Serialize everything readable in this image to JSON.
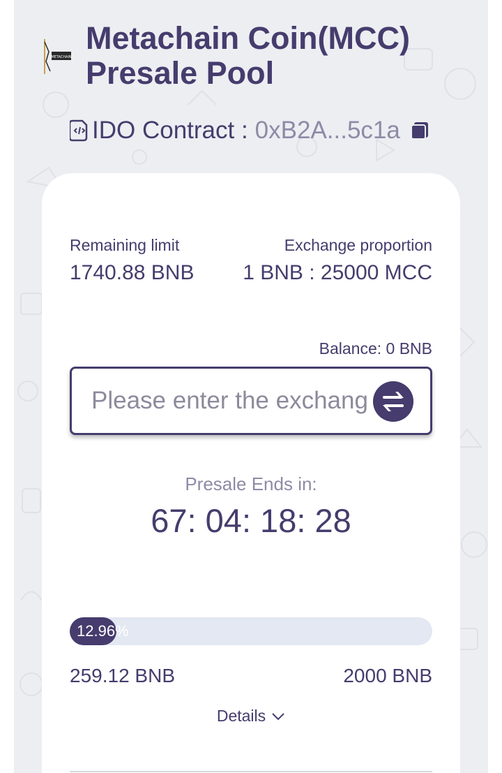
{
  "header": {
    "title_line1": "Metachain Coin(MCC)",
    "title_line2": "Presale Pool",
    "logo_text": "METACHAIN"
  },
  "contract": {
    "label": "IDO Contract :",
    "address": "0xB2A...5c1a"
  },
  "stats": {
    "remaining_label": "Remaining limit",
    "remaining_value": "1740.88 BNB",
    "exchange_label": "Exchange proportion",
    "exchange_value": "1 BNB : 25000 MCC"
  },
  "balance": "Balance: 0 BNB",
  "exchange_input": {
    "placeholder": "Please enter the exchange amount",
    "value": ""
  },
  "presale": {
    "ends_label": "Presale Ends in:",
    "countdown": "67: 04: 18: 28"
  },
  "progress": {
    "percent_label": "12.96%",
    "fraction": 0.1296,
    "raised": "259.12 BNB",
    "cap": "2000 BNB"
  },
  "details_label": "Details",
  "colors": {
    "primary": "#463c6d",
    "track": "#e3e8f2",
    "muted": "#8e8aa6",
    "background": "#eceef2"
  }
}
